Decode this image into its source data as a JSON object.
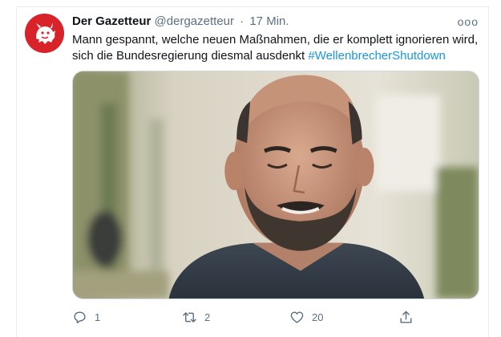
{
  "tweet": {
    "author_name": "Der Gazetteur",
    "author_handle": "@dergazetteur",
    "separator": "·",
    "time": "17 Min.",
    "more_label": "ooo",
    "text": "Mann gespannt, welche neuen Maßnahmen, die er komplett ignorieren wird, sich die Bundesregierung diesmal ausdenkt",
    "hashtag": "#WellenbrecherShutdown",
    "avatar_icon": "red-bull-logo-icon",
    "media_description_icon": "photo",
    "actions": {
      "reply": {
        "icon": "reply-icon",
        "count": "1"
      },
      "retweet": {
        "icon": "retweet-icon",
        "count": "2"
      },
      "like": {
        "icon": "heart-icon",
        "count": "20"
      },
      "share": {
        "icon": "share-icon",
        "count": ""
      }
    }
  },
  "colors": {
    "hashtag": "#1b95e0",
    "muted": "#5b7083",
    "avatar_bg": "#d9232b"
  }
}
